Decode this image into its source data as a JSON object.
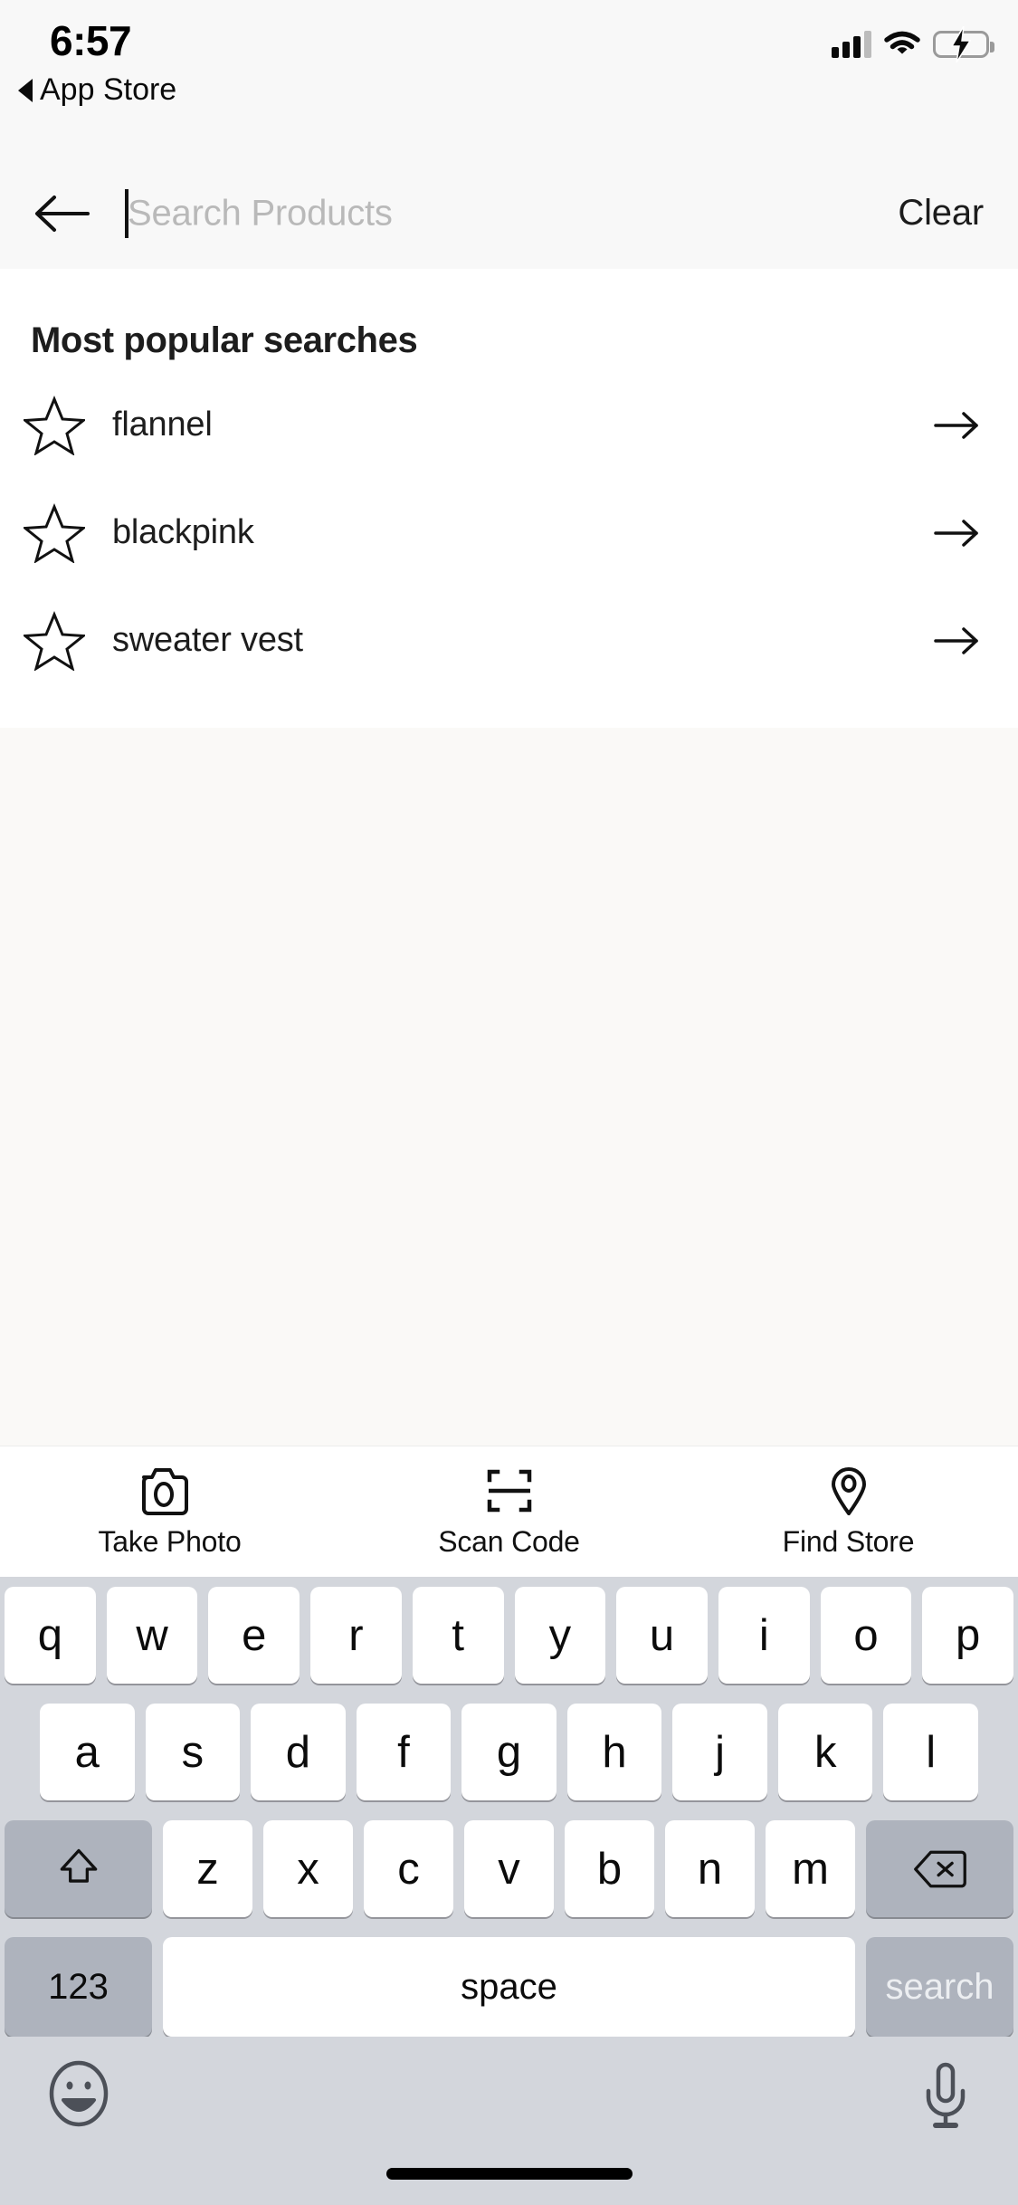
{
  "status_bar": {
    "time": "6:57",
    "back_app_label": "App Store",
    "signal_bars_filled": 3,
    "signal_bars_total": 4,
    "wifi": "wifi-icon",
    "battery_state": "charging",
    "battery_color": "#4cd964"
  },
  "search_bar": {
    "back_icon": "arrow-left-icon",
    "placeholder": "Search Products",
    "value": "",
    "clear_label": "Clear"
  },
  "suggestions": {
    "title": "Most popular searches",
    "items": [
      {
        "icon": "star-icon",
        "label": "flannel",
        "action_icon": "arrow-right-icon"
      },
      {
        "icon": "star-icon",
        "label": "blackpink",
        "action_icon": "arrow-right-icon"
      },
      {
        "icon": "star-icon",
        "label": "sweater vest",
        "action_icon": "arrow-right-icon"
      }
    ]
  },
  "action_bar": {
    "actions": [
      {
        "icon": "camera-icon",
        "label": "Take Photo"
      },
      {
        "icon": "scan-code-icon",
        "label": "Scan Code"
      },
      {
        "icon": "location-pin-icon",
        "label": "Find Store"
      }
    ]
  },
  "keyboard": {
    "row1": [
      "q",
      "w",
      "e",
      "r",
      "t",
      "y",
      "u",
      "i",
      "o",
      "p"
    ],
    "row2": [
      "a",
      "s",
      "d",
      "f",
      "g",
      "h",
      "j",
      "k",
      "l"
    ],
    "row3": [
      "z",
      "x",
      "c",
      "v",
      "b",
      "n",
      "m"
    ],
    "shift_icon": "shift-arrow-icon",
    "backspace_icon": "backspace-icon",
    "numbers_label": "123",
    "space_label": "space",
    "return_label": "search",
    "emoji_icon": "emoji-smiley-icon",
    "mic_icon": "microphone-icon"
  },
  "theme": {
    "keyboard_bg": "#d3d6dc",
    "key_bg": "#ffffff",
    "mod_key_bg": "#aeb3bd",
    "page_bg": "#faf9f7",
    "bar_bg": "#f8f8f8"
  }
}
